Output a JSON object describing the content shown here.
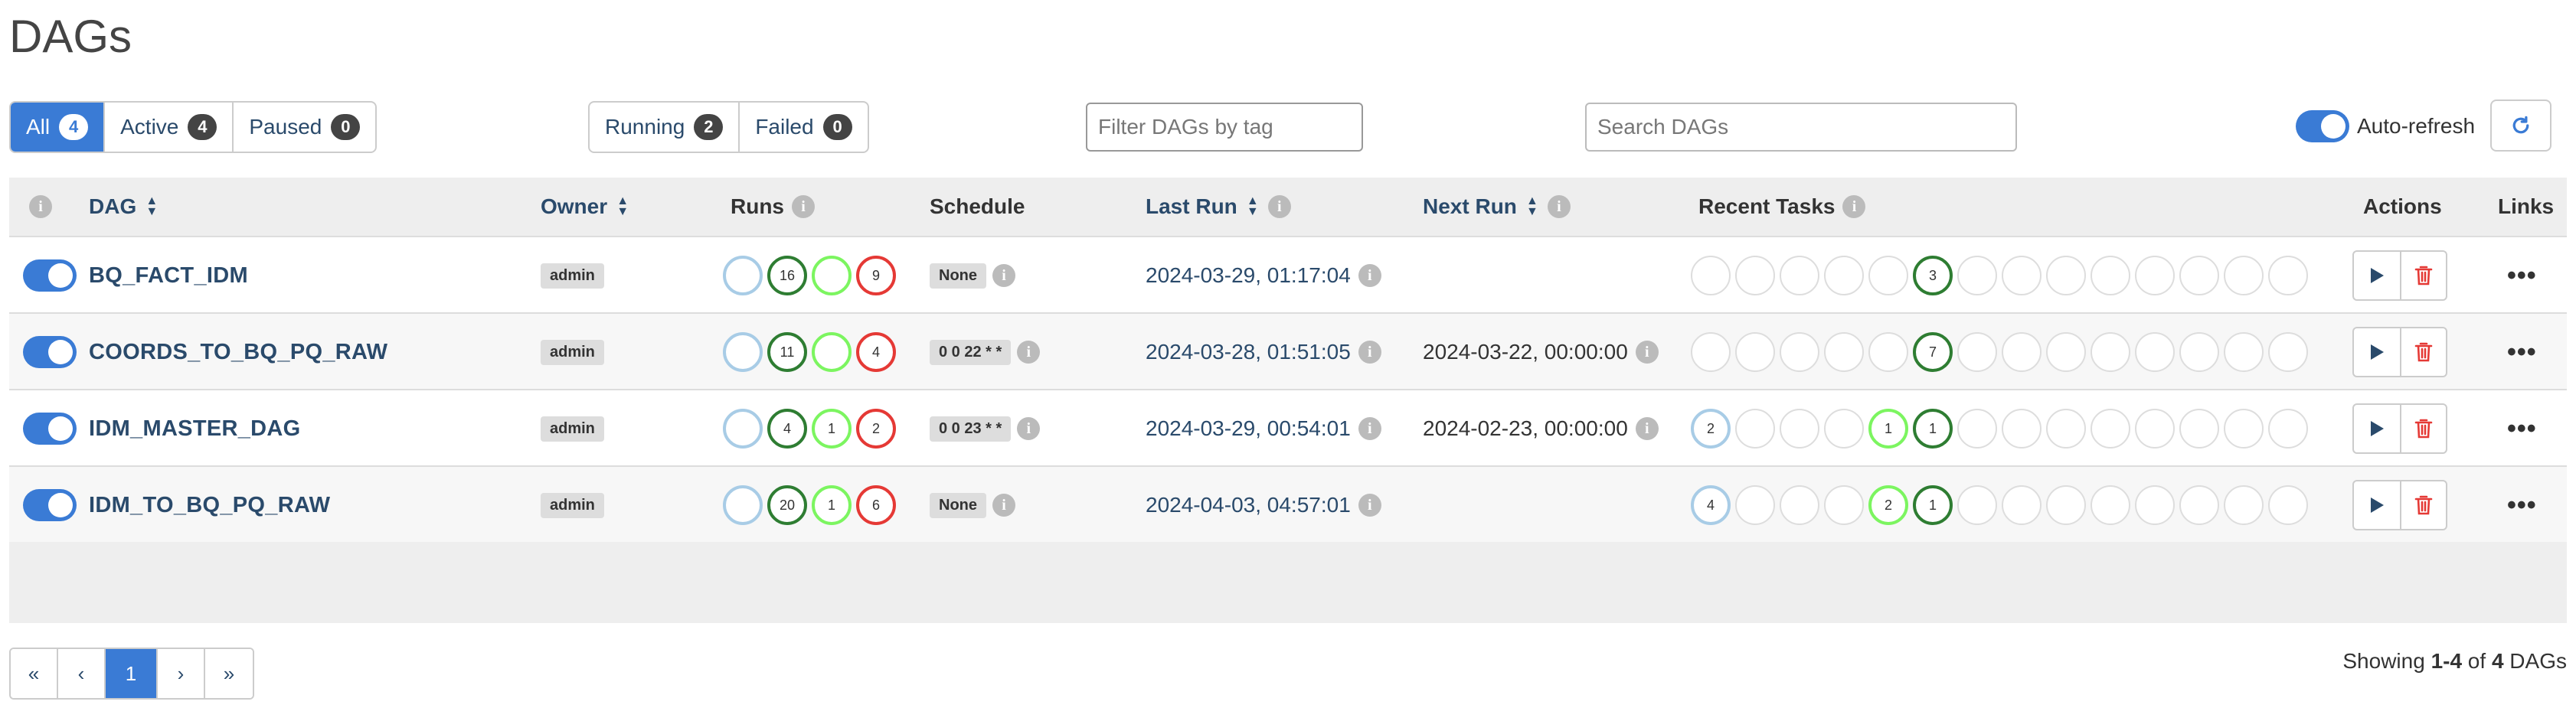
{
  "page": {
    "title": "DAGs"
  },
  "status_filters": [
    {
      "label": "All",
      "count": "4",
      "active": true
    },
    {
      "label": "Active",
      "count": "4",
      "active": false
    },
    {
      "label": "Paused",
      "count": "0",
      "active": false
    }
  ],
  "run_filters": [
    {
      "label": "Running",
      "count": "2"
    },
    {
      "label": "Failed",
      "count": "0"
    }
  ],
  "tag_filter": {
    "placeholder": "Filter DAGs by tag",
    "value": ""
  },
  "search": {
    "placeholder": "Search DAGs",
    "value": ""
  },
  "auto_refresh": {
    "label": "Auto-refresh",
    "enabled": true
  },
  "table": {
    "headers": {
      "dag": "DAG",
      "owner": "Owner",
      "runs": "Runs",
      "schedule": "Schedule",
      "last_run": "Last Run",
      "next_run": "Next Run",
      "recent_tasks": "Recent Tasks",
      "actions": "Actions",
      "links": "Links"
    },
    "rows": [
      {
        "dag_id": "BQ_FACT_IDM",
        "owner": "admin",
        "runs": [
          {
            "state": "queued",
            "count": ""
          },
          {
            "state": "success",
            "count": "16"
          },
          {
            "state": "running",
            "count": ""
          },
          {
            "state": "failed",
            "count": "9"
          }
        ],
        "schedule": "None",
        "last_run": "2024-03-29, 01:17:04",
        "next_run": "",
        "recent_tasks": [
          "",
          "",
          "",
          "",
          "",
          "3",
          "",
          "",
          "",
          "",
          "",
          "",
          "",
          ""
        ],
        "recent_task_states": [
          "none",
          "none",
          "none",
          "none",
          "none",
          "success",
          "none",
          "none",
          "none",
          "none",
          "none",
          "none",
          "none",
          "none"
        ]
      },
      {
        "dag_id": "COORDS_TO_BQ_PQ_RAW",
        "owner": "admin",
        "runs": [
          {
            "state": "queued",
            "count": ""
          },
          {
            "state": "success",
            "count": "11"
          },
          {
            "state": "running",
            "count": ""
          },
          {
            "state": "failed",
            "count": "4"
          }
        ],
        "schedule": "0 0 22 * *",
        "last_run": "2024-03-28, 01:51:05",
        "next_run": "2024-03-22, 00:00:00",
        "recent_tasks": [
          "",
          "",
          "",
          "",
          "",
          "7",
          "",
          "",
          "",
          "",
          "",
          "",
          "",
          ""
        ],
        "recent_task_states": [
          "none",
          "none",
          "none",
          "none",
          "none",
          "success",
          "none",
          "none",
          "none",
          "none",
          "none",
          "none",
          "none",
          "none"
        ]
      },
      {
        "dag_id": "IDM_MASTER_DAG",
        "owner": "admin",
        "runs": [
          {
            "state": "queued",
            "count": ""
          },
          {
            "state": "success",
            "count": "4"
          },
          {
            "state": "running",
            "count": "1"
          },
          {
            "state": "failed",
            "count": "2"
          }
        ],
        "schedule": "0 0 23 * *",
        "last_run": "2024-03-29, 00:54:01",
        "next_run": "2024-02-23, 00:00:00",
        "recent_tasks": [
          "2",
          "",
          "",
          "",
          "1",
          "1",
          "",
          "",
          "",
          "",
          "",
          "",
          "",
          ""
        ],
        "recent_task_states": [
          "queued",
          "none",
          "none",
          "none",
          "running",
          "success",
          "none",
          "none",
          "none",
          "none",
          "none",
          "none",
          "none",
          "none"
        ]
      },
      {
        "dag_id": "IDM_TO_BQ_PQ_RAW",
        "owner": "admin",
        "runs": [
          {
            "state": "queued",
            "count": ""
          },
          {
            "state": "success",
            "count": "20"
          },
          {
            "state": "running",
            "count": "1"
          },
          {
            "state": "failed",
            "count": "6"
          }
        ],
        "schedule": "None",
        "last_run": "2024-04-03, 04:57:01",
        "next_run": "",
        "recent_tasks": [
          "4",
          "",
          "",
          "",
          "2",
          "1",
          "",
          "",
          "",
          "",
          "",
          "",
          "",
          ""
        ],
        "recent_task_states": [
          "queued",
          "none",
          "none",
          "none",
          "running",
          "success",
          "none",
          "none",
          "none",
          "none",
          "none",
          "none",
          "none",
          "none"
        ]
      }
    ]
  },
  "pagination": {
    "first": "«",
    "prev": "‹",
    "current": "1",
    "next": "›",
    "last": "»"
  },
  "showing": {
    "prefix": "Showing ",
    "range": "1-4",
    "middle": " of ",
    "total": "4",
    "suffix": " DAGs"
  },
  "colors": {
    "accent": "#3a7bd5",
    "link": "#2a4a6b",
    "success": "#2e7d32",
    "failed": "#e53935",
    "running": "#7cf560",
    "queued": "#a8cce6",
    "delete": "#e53935"
  },
  "icons": {
    "info": "info-icon",
    "sort": "sort-icon",
    "refresh": "refresh-icon",
    "trigger": "play-icon",
    "delete": "trash-icon",
    "links": "more-dots-icon"
  }
}
